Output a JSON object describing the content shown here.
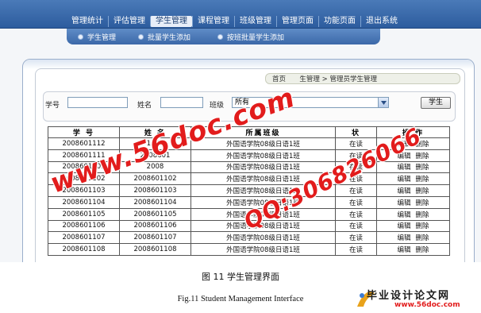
{
  "nav": {
    "items": [
      "管理统计",
      "评估管理",
      "学生管理",
      "课程管理",
      "班级管理",
      "管理页面",
      "功能页面",
      "退出系统"
    ],
    "active_index": 2
  },
  "subnav": {
    "items": [
      "学生管理",
      "批量学生添加",
      "按班批量学生添加"
    ]
  },
  "breadcrumb": {
    "text_left": "首页",
    "text_mid": "生管理",
    "separator": ">",
    "text_right": "管理员学生管理"
  },
  "search": {
    "student_id_label": "学号",
    "student_id_value": "",
    "name_label": "姓名",
    "name_value": "",
    "class_label": "班级",
    "class_selected": "所有",
    "button_label": "学生"
  },
  "table": {
    "headers": [
      "学 号",
      "姓 名",
      "所属班级",
      "状",
      "操 作"
    ],
    "action_edit": "编辑",
    "action_delete": "删除",
    "rows": [
      {
        "id": "2008601112",
        "name": "1121",
        "class": "外国语学院08级日语1班",
        "status": "在读"
      },
      {
        "id": "2008601111",
        "name": "2008601",
        "class": "外国语学院08级日语1班",
        "status": "在读"
      },
      {
        "id": "2008601101",
        "name": "2008",
        "class": "外国语学院08级日语1班",
        "status": "在读"
      },
      {
        "id": "2008601102",
        "name": "2008601102",
        "class": "外国语学院08级日语1班",
        "status": "在读"
      },
      {
        "id": "2008601103",
        "name": "2008601103",
        "class": "外国语学院08级日语1班",
        "status": "在读"
      },
      {
        "id": "2008601104",
        "name": "2008601104",
        "class": "外国语学院08级日语1班",
        "status": "在读"
      },
      {
        "id": "2008601105",
        "name": "2008601105",
        "class": "外国语学院08级日语1班",
        "status": "在读"
      },
      {
        "id": "2008601106",
        "name": "2008601106",
        "class": "外国语学院08级日语1班",
        "status": "在读"
      },
      {
        "id": "2008601107",
        "name": "2008601107",
        "class": "外国语学院08级日语1班",
        "status": "在读"
      },
      {
        "id": "2008601108",
        "name": "2008601108",
        "class": "外国语学院08级日语1班",
        "status": "在读"
      }
    ]
  },
  "watermark": {
    "text1": "www.56doc.com",
    "text2": "QQ:306826066",
    "color": "#e21c1c"
  },
  "caption": {
    "cn": "图 11    学生管理界面",
    "en": "Fig.11    Student Management Interface"
  },
  "logo": {
    "text": "毕业设计论文网",
    "url": "www.56doc.com"
  },
  "colors": {
    "nav_bg": "#2d5c9e",
    "accent": "#e21c1c"
  }
}
